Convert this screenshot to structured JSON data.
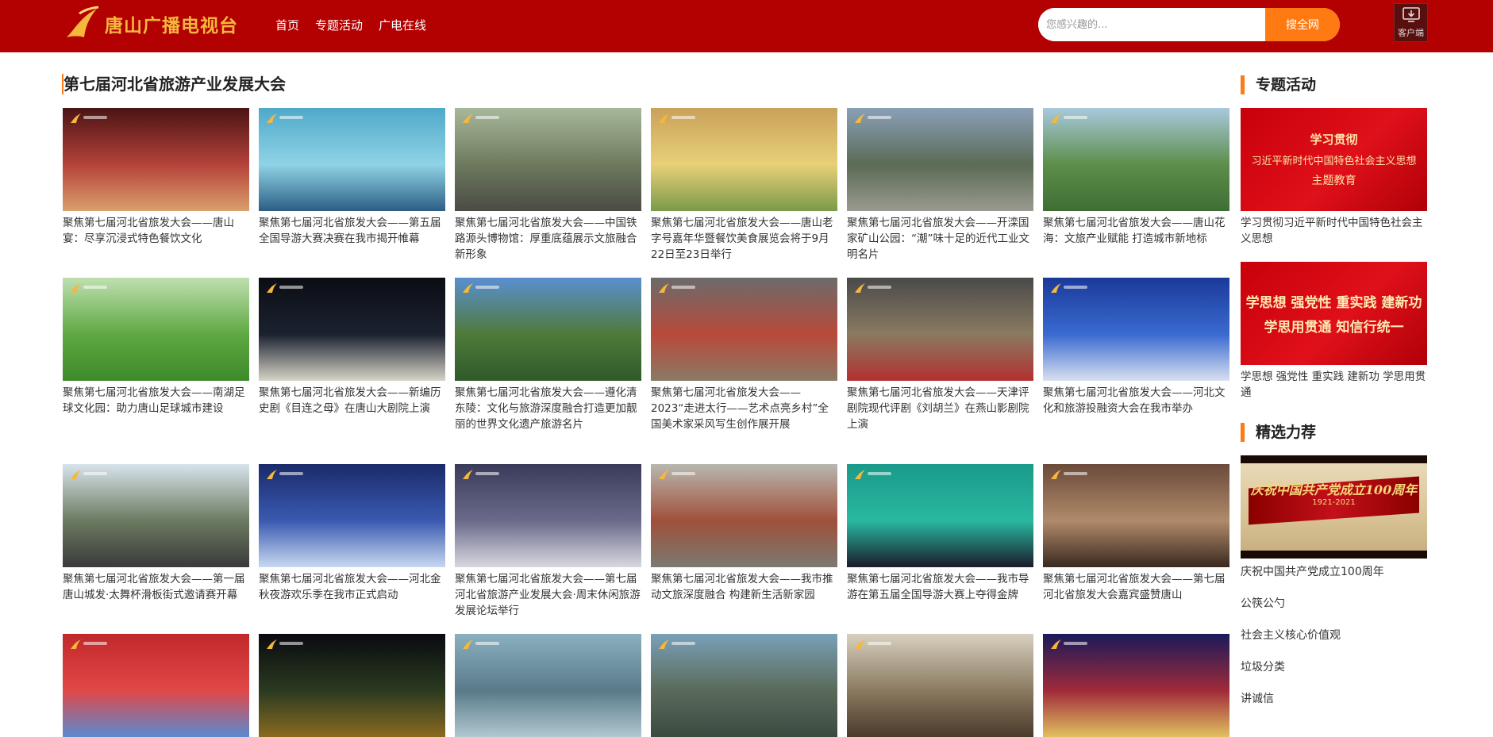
{
  "header": {
    "logo_text": "唐山广播电视台",
    "nav": [
      "首页",
      "专题活动",
      "广电在线"
    ],
    "search_placeholder": "您感兴趣的...",
    "search_button": "搜全网",
    "client_label": "客户端"
  },
  "main": {
    "title": "第七届河北省旅游产业发展大会",
    "cards": [
      {
        "title": "聚焦第七届河北省旅发大会——唐山宴：尽享沉浸式特色餐饮文化",
        "colors": [
          "#4a1414",
          "#b5423a",
          "#d9a06b"
        ]
      },
      {
        "title": "聚焦第七届河北省旅发大会——第五届全国导游大赛决赛在我市揭开帷幕",
        "colors": [
          "#4fa9c9",
          "#8fd3e6",
          "#2c5e85"
        ]
      },
      {
        "title": "聚焦第七届河北省旅发大会——中国铁路源头博物馆：厚重底蕴展示文旅融合新形象",
        "colors": [
          "#a8b89a",
          "#6d7a5e",
          "#4b4b45"
        ]
      },
      {
        "title": "聚焦第七届河北省旅发大会——唐山老字号嘉年华暨餐饮美食展览会将于9月22日至23日举行",
        "colors": [
          "#c9a15a",
          "#e8d078",
          "#7a9a4a"
        ]
      },
      {
        "title": "聚焦第七届河北省旅发大会——开滦国家矿山公园：“潮”味十足的近代工业文明名片",
        "colors": [
          "#8aa0b8",
          "#5b6b55",
          "#9a9a90"
        ]
      },
      {
        "title": "聚焦第七届河北省旅发大会——唐山花海：文旅产业赋能 打造城市新地标",
        "colors": [
          "#a9c9de",
          "#5d8e4a",
          "#3f6e34"
        ]
      },
      {
        "title": "聚焦第七届河北省旅发大会——南湖足球文化园：助力唐山足球城市建设",
        "colors": [
          "#bfe0b0",
          "#5fa842",
          "#3d8a2a"
        ]
      },
      {
        "title": "聚焦第七届河北省旅发大会——新编历史剧《目连之母》在唐山大剧院上演",
        "colors": [
          "#0b0d14",
          "#1b2230",
          "#d8d4c8"
        ]
      },
      {
        "title": "聚焦第七届河北省旅发大会——遵化清东陵：文化与旅游深度融合打造更加靓丽的世界文化遗产旅游名片",
        "colors": [
          "#5a8fd0",
          "#4f7a3a",
          "#2f5a2a"
        ]
      },
      {
        "title": "聚焦第七届河北省旅发大会——2023“走进太行——艺术点亮乡村”全国美术家采风写生创作展开展",
        "colors": [
          "#6b6b6b",
          "#b84a3a",
          "#8a7a66"
        ]
      },
      {
        "title": "聚焦第七届河北省旅发大会——天津评剧院现代评剧《刘胡兰》在燕山影剧院上演",
        "colors": [
          "#4a4a4a",
          "#8a7a60",
          "#b23030"
        ]
      },
      {
        "title": "聚焦第七届河北省旅发大会——河北文化和旅游投融资大会在我市举办",
        "colors": [
          "#1a3a9a",
          "#3a6ad0",
          "#d8e0f0"
        ]
      },
      {
        "title": "聚焦第七届河北省旅发大会——第一届唐山城发·太舞杯滑板街式邀请赛开幕",
        "colors": [
          "#d8e4ec",
          "#6b7a60",
          "#3a3a3a"
        ]
      },
      {
        "title": "聚焦第七届河北省旅发大会——河北金秋夜游欢乐季在我市正式启动",
        "colors": [
          "#1a2a6a",
          "#3a5ab0",
          "#c8d8f0"
        ]
      },
      {
        "title": "聚焦第七届河北省旅发大会——第七届河北省旅游产业发展大会·周末休闲旅游发展论坛举行",
        "colors": [
          "#3a3a5a",
          "#6a6a8a",
          "#d8d8e0"
        ]
      },
      {
        "title": "聚焦第七届河北省旅发大会——我市推动文旅深度融合 构建新生活新家园",
        "colors": [
          "#b8b8b0",
          "#a0503a",
          "#7a7a70"
        ]
      },
      {
        "title": "聚焦第七届河北省旅发大会——我市导游在第五届全国导游大赛上夺得金牌",
        "colors": [
          "#1a9a8a",
          "#2ab8a0",
          "#1a1a2a"
        ]
      },
      {
        "title": "聚焦第七届河北省旅发大会——第七届河北省旅发大会嘉宾盛赞唐山",
        "colors": [
          "#6a4a3a",
          "#b08a6a",
          "#3a2a20"
        ]
      },
      {
        "title": "",
        "colors": [
          "#c0282a",
          "#e04848",
          "#5a8ad0"
        ]
      },
      {
        "title": "",
        "colors": [
          "#0a0a10",
          "#2a3a20",
          "#8a6a20"
        ]
      },
      {
        "title": "",
        "colors": [
          "#8ab0c0",
          "#5a7a8a",
          "#b0c8d0"
        ]
      },
      {
        "title": "",
        "colors": [
          "#7aa0b8",
          "#5a6a5a",
          "#3a4a40"
        ]
      },
      {
        "title": "",
        "colors": [
          "#d8d0c0",
          "#8a7a60",
          "#4a3a2a"
        ]
      },
      {
        "title": "",
        "colors": [
          "#1a1a5a",
          "#a02a3a",
          "#e0c060"
        ]
      }
    ]
  },
  "sidebar": {
    "topic_heading": "专题活动",
    "banner1": {
      "line1": "学习贯彻",
      "line2": "习近平新时代中国特色社会主义思想",
      "line3": "主题教育"
    },
    "banner1_caption": "学习贯彻习近平新时代中国特色社会主义思想",
    "banner2": {
      "line1": "学思想 强党性 重实践 建新功",
      "line2": "学思用贯通 知信行统一"
    },
    "banner2_caption": "学思想 强党性 重实践 建新功 学思用贯通",
    "picks_heading": "精选力荐",
    "pick_image": {
      "line1": "庆祝中国共产党成立100周年",
      "line2": "1921-2021"
    },
    "pick_links": [
      "庆祝中国共产党成立100周年",
      "公筷公勺",
      "社会主义核心价值观",
      "垃圾分类",
      "讲诚信"
    ]
  }
}
